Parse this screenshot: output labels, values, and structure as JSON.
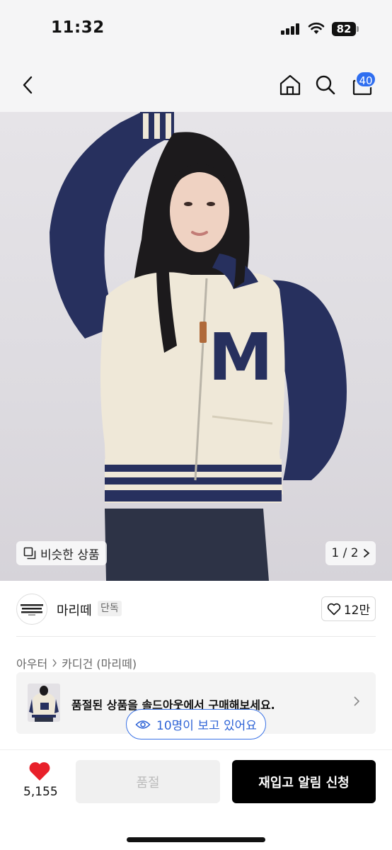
{
  "status_bar": {
    "time": "11:32",
    "battery": "82"
  },
  "nav": {
    "cart_count": "40"
  },
  "hero": {
    "similar_label": "비슷한 상품",
    "pager": "1 / 2",
    "sweater_letter": "M"
  },
  "brand": {
    "logo_text": "MARITHE FRANCOIS GIRBAUD",
    "name": "마리떼",
    "tag": "단독",
    "like_count": "12만"
  },
  "category": {
    "parent": "아우터",
    "child": "카디건 (마리떼)"
  },
  "soldout_banner": {
    "text": "품절된 상품을 솔드아웃에서 구매해보세요."
  },
  "viewers": {
    "text": "10명이 보고 있어요"
  },
  "bottom": {
    "like_total": "5,155",
    "soldout_label": "품절",
    "restock_label": "재입고 알림 신청"
  },
  "colors": {
    "accent_blue": "#2f6ef0",
    "heart_red": "#e8202a",
    "navy": "#27305e",
    "cream": "#efe8d8"
  }
}
